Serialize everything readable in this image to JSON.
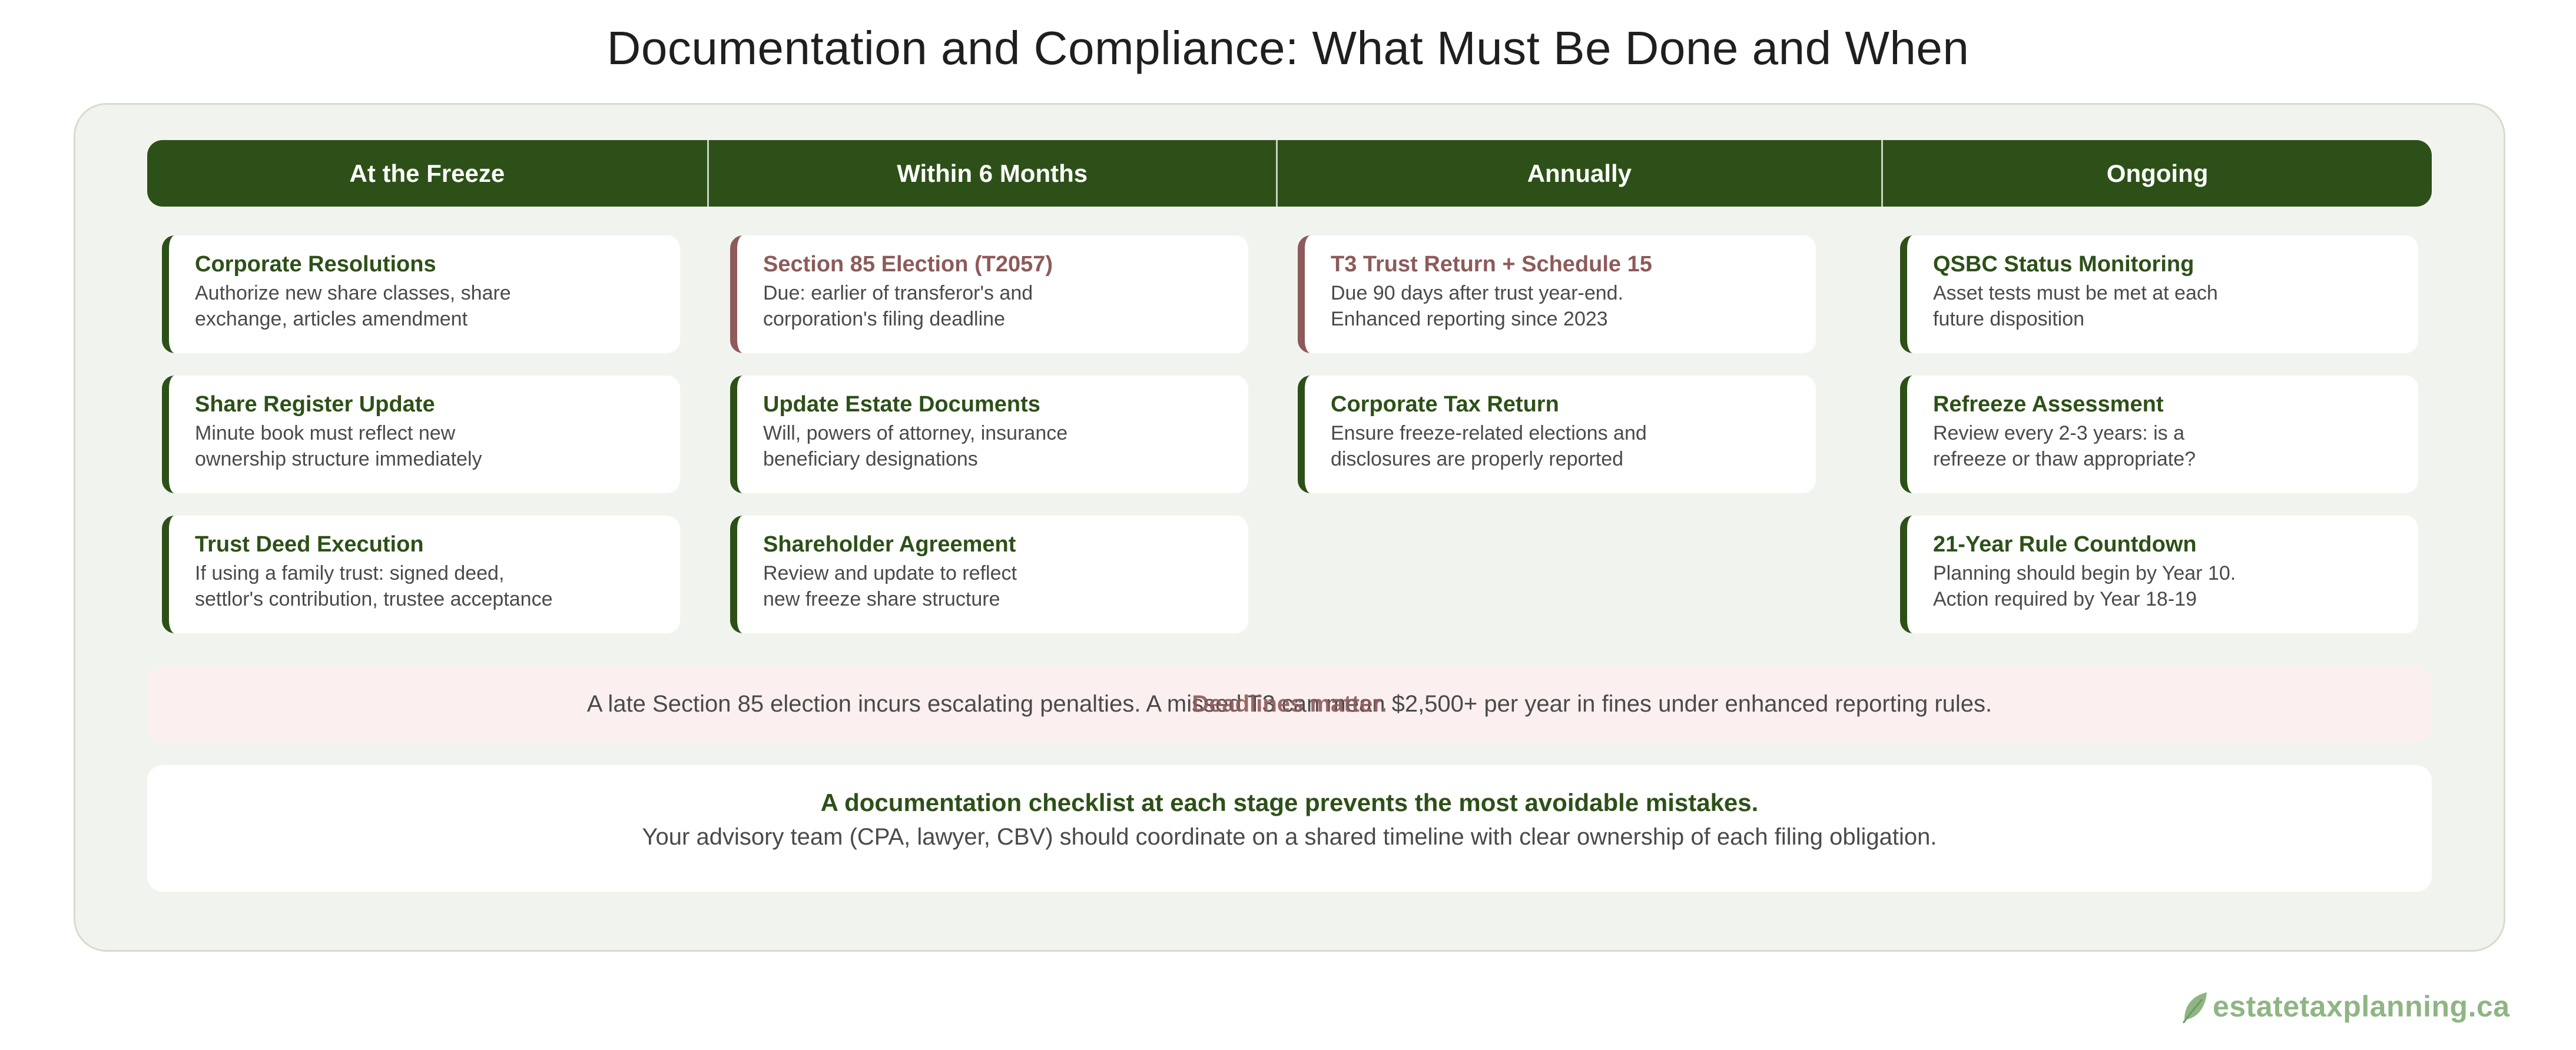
{
  "title": "Documentation and Compliance: What Must Be Done and When",
  "columns": [
    {
      "header": "At the Freeze",
      "cards": [
        {
          "title": "Corporate Resolutions",
          "desc": "Authorize new share classes, share\nexchange, articles amendment",
          "accent": "green"
        },
        {
          "title": "Share Register Update",
          "desc": "Minute book must reflect new\nownership structure immediately",
          "accent": "green"
        },
        {
          "title": "Trust Deed Execution",
          "desc": "If using a family trust: signed deed,\nsettlor's contribution, trustee acceptance",
          "accent": "green"
        }
      ]
    },
    {
      "header": "Within 6 Months",
      "cards": [
        {
          "title": "Section 85 Election (T2057)",
          "desc": "Due: earlier of transferor's and\ncorporation's filing deadline",
          "accent": "red"
        },
        {
          "title": "Update Estate Documents",
          "desc": "Will, powers of attorney, insurance\nbeneficiary designations",
          "accent": "green"
        },
        {
          "title": "Shareholder Agreement",
          "desc": "Review and update to reflect\nnew freeze share structure",
          "accent": "green"
        }
      ]
    },
    {
      "header": "Annually",
      "cards": [
        {
          "title": "T3 Trust Return + Schedule 15",
          "desc": "Due 90 days after trust year-end.\nEnhanced reporting since 2023",
          "accent": "red"
        },
        {
          "title": "Corporate Tax Return",
          "desc": "Ensure freeze-related elections and\ndisclosures are properly reported",
          "accent": "green"
        }
      ]
    },
    {
      "header": "Ongoing",
      "cards": [
        {
          "title": "QSBC Status Monitoring",
          "desc": "Asset tests must be met at each\nfuture disposition",
          "accent": "green"
        },
        {
          "title": "Refreeze Assessment",
          "desc": "Review every 2-3 years: is a\nrefreeze or thaw appropriate?",
          "accent": "green"
        },
        {
          "title": "21-Year Rule Countdown",
          "desc": "Planning should begin by Year 10.\nAction required by Year 18-19",
          "accent": "green"
        }
      ]
    }
  ],
  "warning": {
    "bold": "Deadlines matter.",
    "text": "A late Section 85 election incurs escalating penalties. A missed T3 can mean $2,500+ per year in fines under enhanced reporting rules."
  },
  "summary": {
    "headline": "A documentation checklist at each stage prevents the most avoidable mistakes.",
    "body": "Your advisory team (CPA, lawyer, CBV) should coordinate on a shared timeline with clear ownership of each filing obligation."
  },
  "brand": {
    "text": "estatetaxplanning.ca",
    "icon": "leaf-icon",
    "color": "#8fb584"
  },
  "colors": {
    "primary": "#2d5018",
    "alert": "#8e5a5a",
    "panel": "#f1f4ee",
    "warning_bg": "#fbf0ef"
  }
}
